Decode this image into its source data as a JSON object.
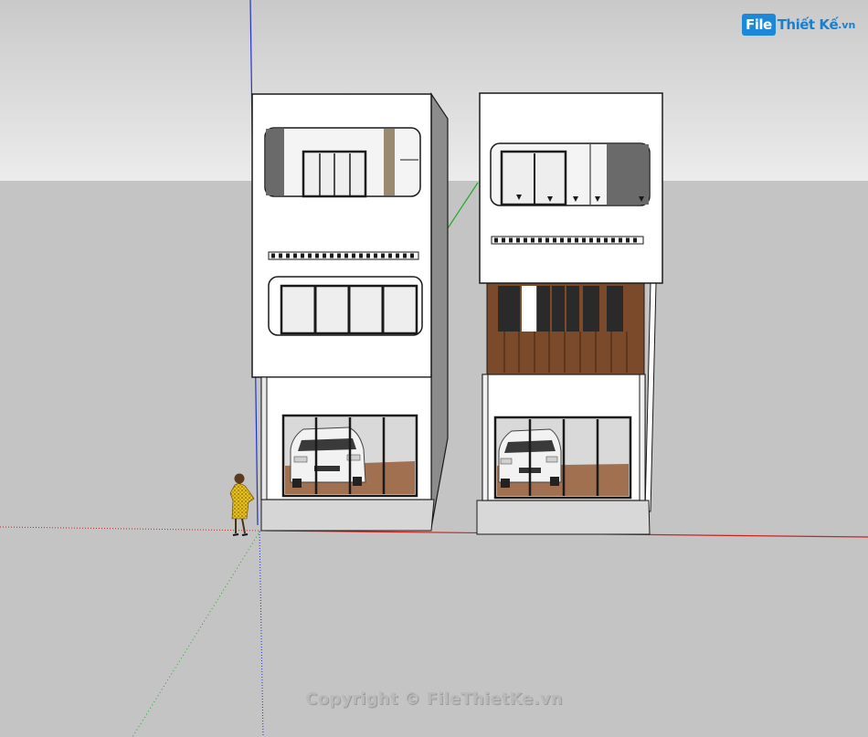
{
  "watermark": {
    "brand_file": "File",
    "brand_rest": "Thiết Kế",
    "brand_tld": ".vn"
  },
  "footer": {
    "copyright": "Copyright © FileThietKe.vn"
  },
  "colors": {
    "sky_top": "#c9c9c9",
    "sky_bottom": "#ececec",
    "ground": "#c4c4c4",
    "wall": "#ffffff",
    "wood": "#7a4a2a",
    "glass": "#eeeeee",
    "frame": "#1a1a1a",
    "axis_red": "#cc2222",
    "axis_green": "#22aa22",
    "axis_blue": "#2233cc"
  },
  "scene": {
    "figure_description_icon": "person-silhouette-icon",
    "car_icon": "car-icon"
  }
}
